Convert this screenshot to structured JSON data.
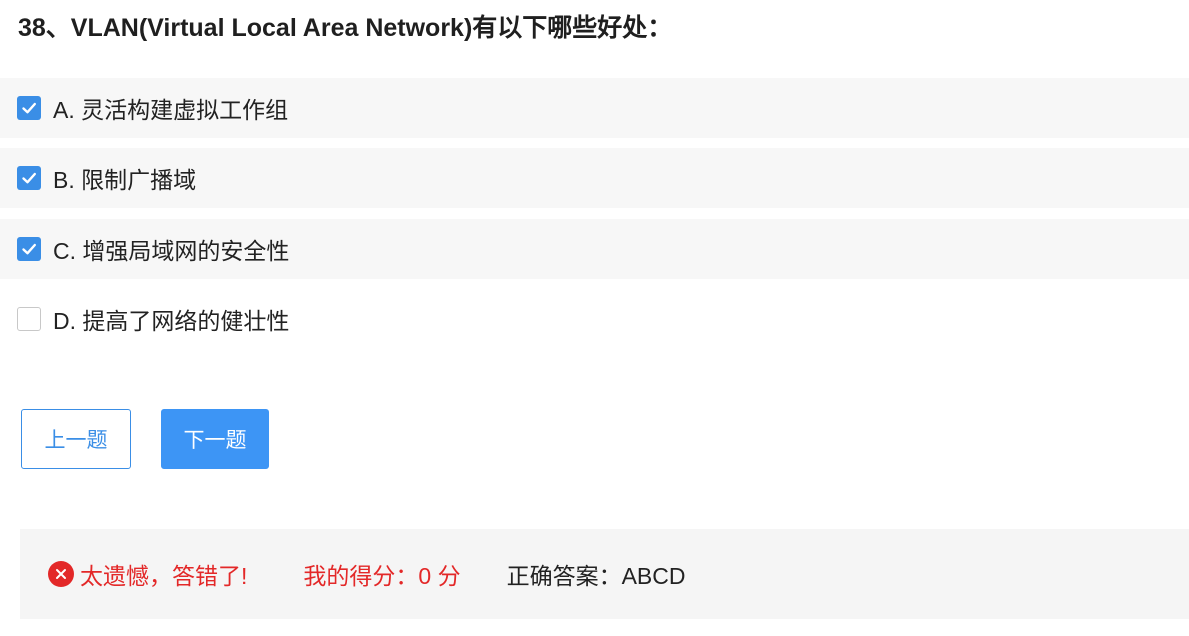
{
  "question": {
    "title": "38、VLAN(Virtual Local Area Network)有以下哪些好处："
  },
  "options": [
    {
      "text": "A. 灵活构建虚拟工作组",
      "checked": true
    },
    {
      "text": "B. 限制广播域",
      "checked": true
    },
    {
      "text": "C. 增强局域网的安全性",
      "checked": true
    },
    {
      "text": "D. 提高了网络的健壮性",
      "checked": false
    }
  ],
  "nav": {
    "prev_label": "上一题",
    "next_label": "下一题"
  },
  "result": {
    "message": "太遗憾，答错了!",
    "score_text": "我的得分：0 分",
    "answer_text": "正确答案：ABCD"
  },
  "colors": {
    "accent": "#3a8ee6",
    "error": "#e32828",
    "option_bg": "#f7f7f7",
    "panel_bg": "#f5f5f5"
  }
}
